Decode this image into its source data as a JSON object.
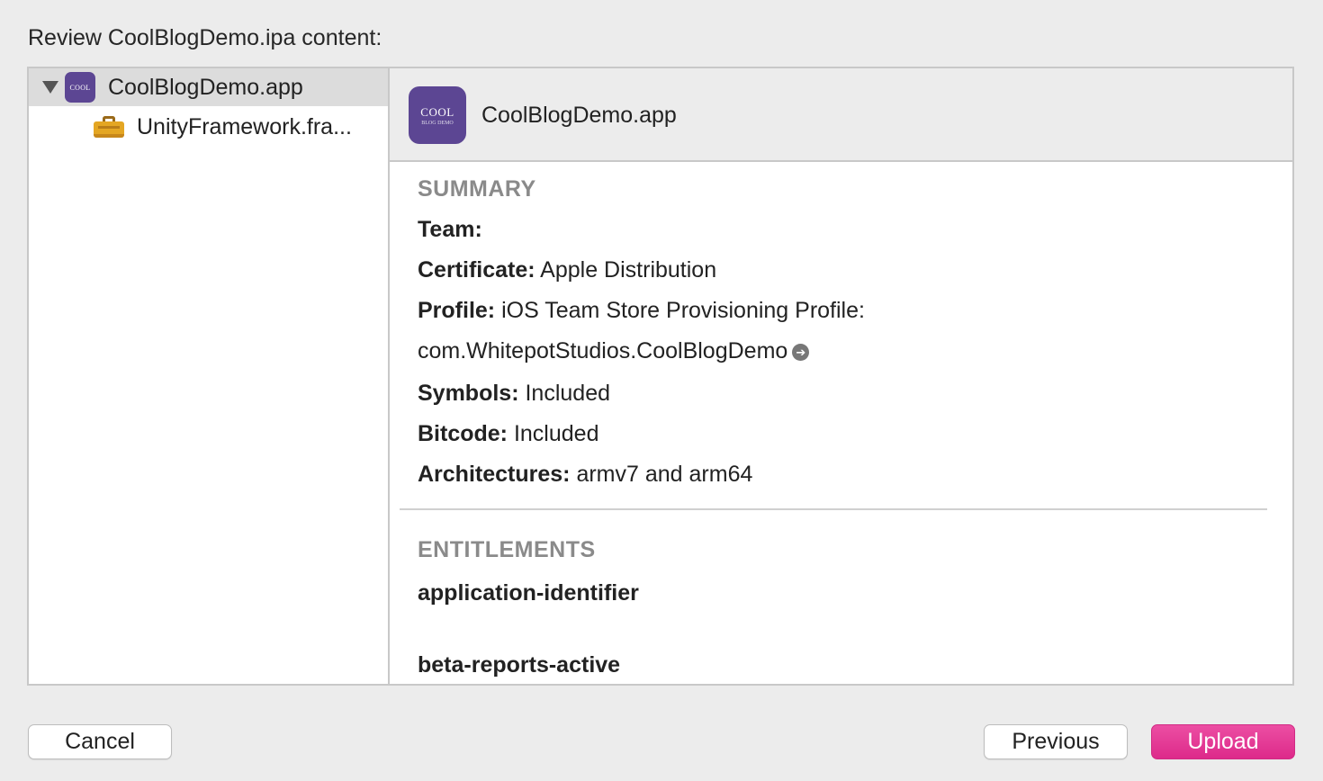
{
  "dialog": {
    "title": "Review CoolBlogDemo.ipa content:"
  },
  "sidebar": {
    "items": [
      {
        "label": "CoolBlogDemo.app",
        "icon": "app-icon",
        "selected": true,
        "expanded": true
      },
      {
        "label": "UnityFramework.fra...",
        "icon": "toolbox-icon",
        "selected": false
      }
    ]
  },
  "detail": {
    "header_title": "CoolBlogDemo.app",
    "icon_text": "COOL",
    "icon_subtext": "BLOG DEMO",
    "summary": {
      "heading": "SUMMARY",
      "team_label": "Team:",
      "team_value": "",
      "certificate_label": "Certificate:",
      "certificate_value": "Apple Distribution",
      "profile_label": "Profile:",
      "profile_value": "iOS Team Store Provisioning Profile:",
      "profile_bundle": "com.WhitepotStudios.CoolBlogDemo",
      "symbols_label": "Symbols:",
      "symbols_value": "Included",
      "bitcode_label": "Bitcode:",
      "bitcode_value": "Included",
      "architectures_label": "Architectures:",
      "architectures_value": "armv7 and arm64"
    },
    "entitlements": {
      "heading": "ENTITLEMENTS",
      "items": [
        "application-identifier",
        "beta-reports-active"
      ]
    }
  },
  "buttons": {
    "cancel": "Cancel",
    "previous": "Previous",
    "upload": "Upload"
  },
  "colors": {
    "accent": "#e0318f",
    "app_icon": "#5c4693"
  }
}
